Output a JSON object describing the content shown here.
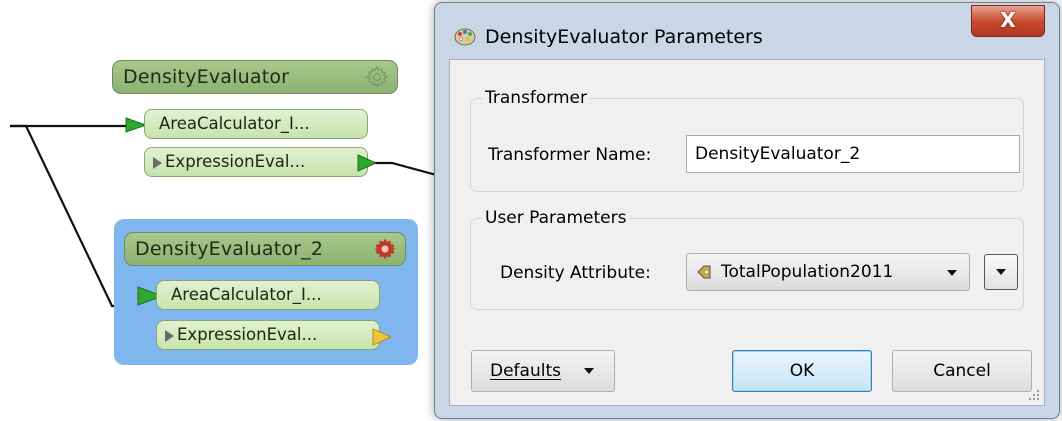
{
  "canvas": {
    "transformers": [
      {
        "name": "DensityEvaluator",
        "selected": false,
        "gear_icon": "gear-icon",
        "gear_color": "#7d9e66",
        "input_port": "AreaCalculator_I...",
        "output_port": "ExpressionEval..."
      },
      {
        "name": "DensityEvaluator_2",
        "selected": true,
        "gear_icon": "gear-icon",
        "gear_color": "#c0392b",
        "input_port": "AreaCalculator_I...",
        "output_port": "ExpressionEval..."
      }
    ],
    "selection_color": "#7fb6ee",
    "input_arrow_color": "#2fa82f",
    "unconnected_output_color": "#f2c53a"
  },
  "dialog": {
    "title": "DensityEvaluator Parameters",
    "app_icon": "palette-icon",
    "close_label": "X",
    "transformer_group": {
      "title": "Transformer",
      "name_label": "Transformer Name:",
      "name_value": "DensityEvaluator_2"
    },
    "user_parameters_group": {
      "title": "User Parameters",
      "density_label": "Density Attribute:",
      "density_value": "TotalPopulation2011",
      "attribute_icon": "attribute-icon"
    },
    "buttons": {
      "defaults": "Defaults",
      "ok": "OK",
      "cancel": "Cancel"
    }
  }
}
